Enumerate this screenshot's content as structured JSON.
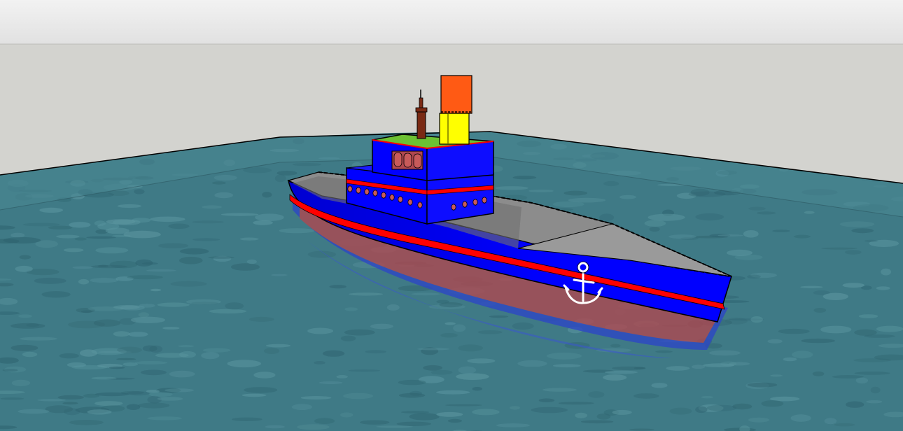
{
  "colors": {
    "sky_top": "#f2f2f2",
    "sky_bottom": "#e1e1e1",
    "back_wall": "#d3d3cf",
    "water_base": "#3f7a86",
    "water_light": "#5b96a0",
    "water_dark": "#2f6470",
    "hull_blue": "#0000ff",
    "hull_stripe": "#ff0000",
    "underwater_red": "#b0474f",
    "underwater_blue": "#2d46c6",
    "deck_gray": "#8c8c8c",
    "deck_light": "#9a9a9a",
    "cabin_roof_green": "#6cc133",
    "funnel_yellow": "#ffff00",
    "funnel_orange": "#ff5a14",
    "mast_brown": "#7a2a14",
    "porthole_red": "#c85a5a",
    "anchor_white": "#ffffff",
    "outline": "#000000"
  },
  "icons": {
    "hull_emblem": "anchor-icon"
  }
}
